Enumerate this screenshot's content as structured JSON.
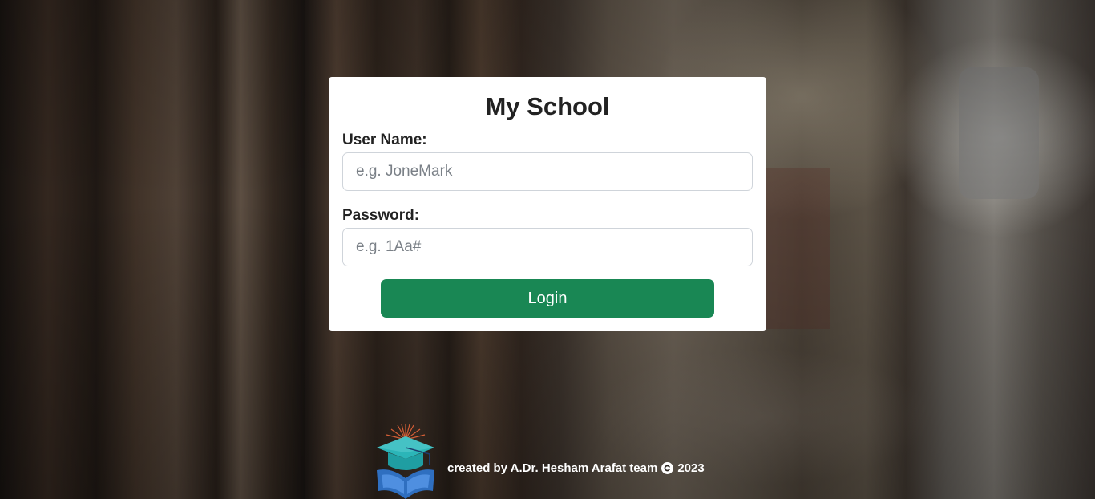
{
  "login_form": {
    "title": "My School",
    "username": {
      "label": "User Name:",
      "placeholder": "e.g. JoneMark",
      "value": ""
    },
    "password": {
      "label": "Password:",
      "placeholder": "e.g. 1Aa#",
      "value": ""
    },
    "submit_label": "Login"
  },
  "footer": {
    "credit_text": "created by A.Dr. Hesham Arafat team",
    "copyright_icon": "copyright-icon",
    "year": "2023",
    "logo_icon": "graduation-cap-book-logo"
  },
  "colors": {
    "accent": "#198754",
    "card_background": "#ffffff",
    "title_text": "#222222",
    "logo_cap": "#2bb5b8",
    "logo_book": "#2f6fc0",
    "logo_rays": "#e8663a"
  }
}
